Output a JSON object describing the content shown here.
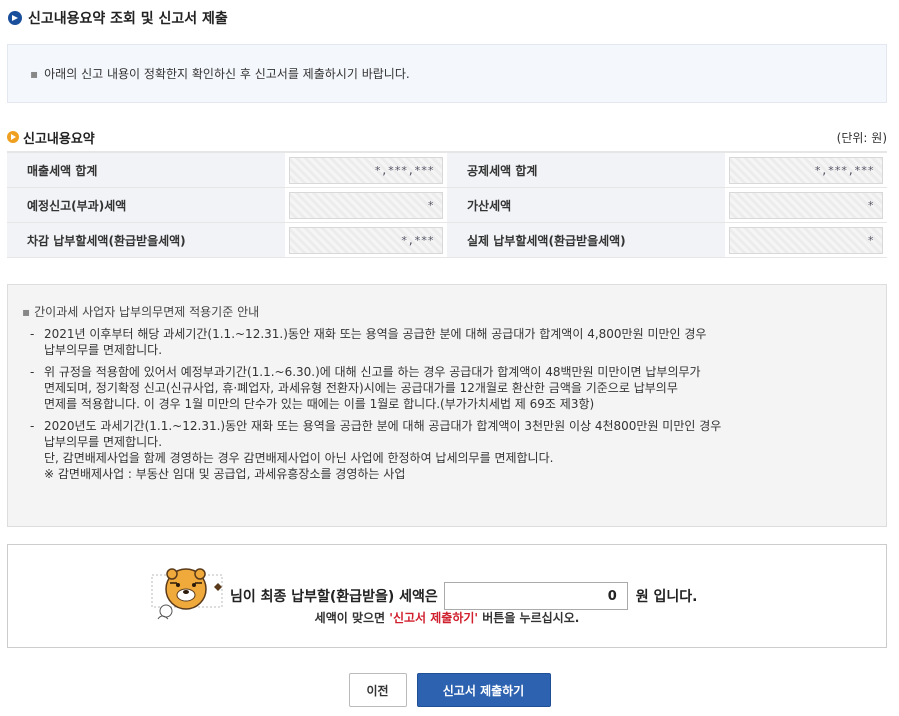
{
  "page": {
    "title": "신고내용요약 조회 및 신고서 제출"
  },
  "notice": {
    "bullet": "▪",
    "text": "아래의 신고 내용이 정확한지 확인하신 후 신고서를 제출하시기 바랍니다."
  },
  "summary": {
    "title": "신고내용요약",
    "unit": "(단위: 원)",
    "rows": [
      {
        "left_label": "매출세액 합계",
        "left_value": "*,***,***",
        "right_label": "공제세액 합계",
        "right_value": "*,***,***"
      },
      {
        "left_label": "예정신고(부과)세액",
        "left_value": "*",
        "right_label": "가산세액",
        "right_value": "*"
      },
      {
        "left_label": "차감 납부할세액(환급받을세액)",
        "left_value": "*,***",
        "right_label": "실제 납부할세액(환급받을세액)",
        "right_value": "*"
      }
    ]
  },
  "info": {
    "heading": "간이과세 사업자 납부의무면제 적용기준 안내",
    "items": [
      {
        "dash": "-",
        "lines": [
          "2021년 이후부터 해당  과세기간(1.1.~12.31.)동안 재화 또는 용역을 공급한 분에 대해 공급대가 합계액이 4,800만원 미만인 경우",
          "납부의무를 면제합니다."
        ]
      },
      {
        "dash": "-",
        "lines": [
          "위 규정을 적용함에 있어서 예정부과기간(1.1.~6.30.)에 대해 신고를 하는 경우 공급대가 합계액이 48백만원 미만이면 납부의무가",
          "면제되며, 정기확정 신고(신규사업, 휴·폐업자, 과세유형 전환자)시에는 공급대가를 12개월로 환산한 금액을 기준으로 납부의무",
          "면제를 적용합니다. 이 경우 1월 미만의 단수가 있는 때에는 이를 1월로 합니다.(부가가치세법 제 69조 제3항)"
        ]
      },
      {
        "dash": "-",
        "lines": [
          "2020년도 과세기간(1.1.~12.31.)동안 재화 또는 용역을 공급한 분에 대해 공급대가 합계액이 3천만원 이상 4천800만원 미만인 경우",
          "납부의무를 면제합니다.",
          "단, 감면배제사업을 함께 경영하는 경우 감면배제사업이 아닌 사업에 한정하여 납세의무를 면제합니다.",
          " ※ 감면배제사업 : 부동산 임대 및 공급업, 과세유흥장소를 경영하는 사업"
        ]
      }
    ]
  },
  "result": {
    "prefix": "님이 최종 납부할(환급받을) 세액은",
    "amount": "0",
    "suffix": "원 입니다.",
    "sub_before": "세액이 맞으면 ",
    "sub_highlight": "'신고서 제출하기'",
    "sub_after": " 버튼을 누르십시오."
  },
  "buttons": {
    "prev": "이전",
    "submit": "신고서 제출하기"
  },
  "colors": {
    "accent_blue": "#2d62b0",
    "highlight_red": "#d0202e",
    "section_bullet": "#f0a020"
  }
}
